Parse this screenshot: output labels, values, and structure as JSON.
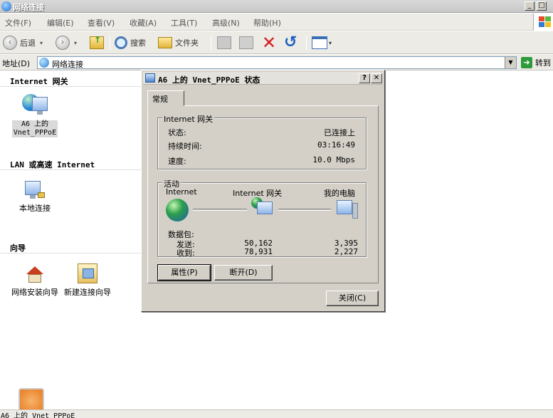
{
  "window": {
    "title": "网络连接"
  },
  "menu": [
    "文件(F)",
    "编辑(E)",
    "查看(V)",
    "收藏(A)",
    "工具(T)",
    "高级(N)",
    "帮助(H)"
  ],
  "toolbar": {
    "back": "后退",
    "search": "搜索",
    "folders": "文件夹"
  },
  "address": {
    "label": "地址(D)",
    "value": "网络连接",
    "go": "转到"
  },
  "sidebar": {
    "groups": [
      {
        "title": "Internet 网关",
        "items": [
          {
            "label": "A6 上的 Vnet_PPPoE",
            "icon": "internet-gateway-icon"
          }
        ]
      },
      {
        "title": "LAN 或高速 Internet",
        "items": [
          {
            "label": "本地连接",
            "icon": "local-connection-icon"
          }
        ]
      },
      {
        "title": "向导",
        "items": [
          {
            "label": "网络安装向导",
            "icon": "network-setup-wizard-icon"
          },
          {
            "label": "新建连接向导",
            "icon": "new-connection-wizard-icon"
          }
        ]
      }
    ]
  },
  "dialog": {
    "title": "A6 上的 Vnet_PPPoE 状态",
    "tab": "常规",
    "gateway_group": "Internet 网关",
    "status_label": "状态:",
    "status_value": "已连接上",
    "duration_label": "持续时间:",
    "duration_value": "03:16:49",
    "speed_label": "速度:",
    "speed_value": "10.0 Mbps",
    "activity_group": "活动",
    "node_internet": "Internet",
    "node_gateway": "Internet 网关",
    "node_computer": "我的电脑",
    "packets_label": "数据包:",
    "sent_label": "发送:",
    "sent_gateway": "50,162",
    "sent_computer": "3,395",
    "received_label": "收到:",
    "received_gateway": "78,931",
    "received_computer": "2,227",
    "properties_button": "属性(P)",
    "disconnect_button": "断开(D)",
    "close_button": "关闭(C)"
  },
  "statusbar": {
    "text": "A6 上的 Vnet_PPPoE"
  }
}
